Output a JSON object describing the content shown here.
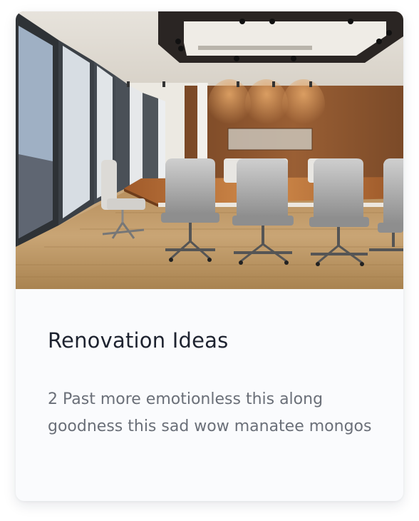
{
  "card": {
    "image_alt": "Modern conference room with long table and office chairs",
    "title": "Renovation Ideas",
    "description": "2 Past more emotionless this along goodness this sad wow manatee mongos"
  }
}
